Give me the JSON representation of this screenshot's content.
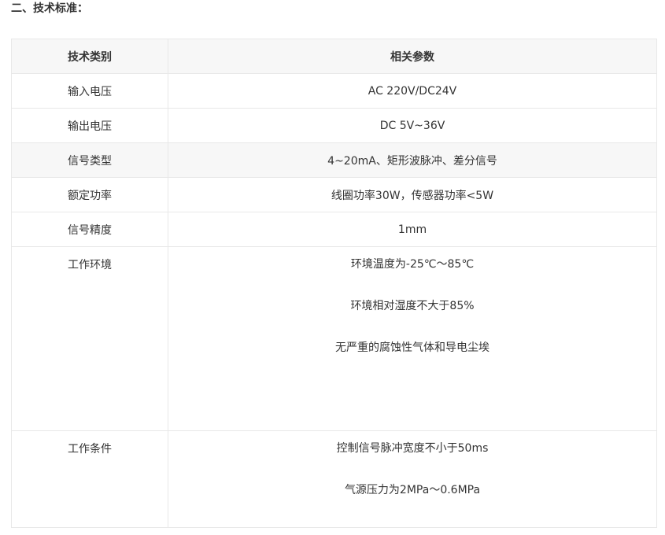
{
  "section": {
    "title": "二、技术标准："
  },
  "table": {
    "headers": [
      "技术类别",
      "相关参数"
    ],
    "rows": [
      {
        "label": "输入电压",
        "values": [
          "AC 220V/DC24V"
        ]
      },
      {
        "label": "输出电压",
        "values": [
          "DC 5V~36V"
        ]
      },
      {
        "label": "信号类型",
        "values": [
          "4~20mA、矩形波脉冲、差分信号"
        ]
      },
      {
        "label": "额定功率",
        "values": [
          "线圈功率30W，传感器功率<5W"
        ]
      },
      {
        "label": "信号精度",
        "values": [
          "1mm"
        ]
      },
      {
        "label": "工作环境",
        "values": [
          "环境温度为-25℃～85℃",
          "环境相对湿度不大于85%",
          "无严重的腐蚀性气体和导电尘埃"
        ]
      },
      {
        "label": "工作条件",
        "values": [
          "控制信号脉冲宽度不小于50ms",
          "气源压力为2MPa～0.6MPa"
        ]
      }
    ]
  }
}
